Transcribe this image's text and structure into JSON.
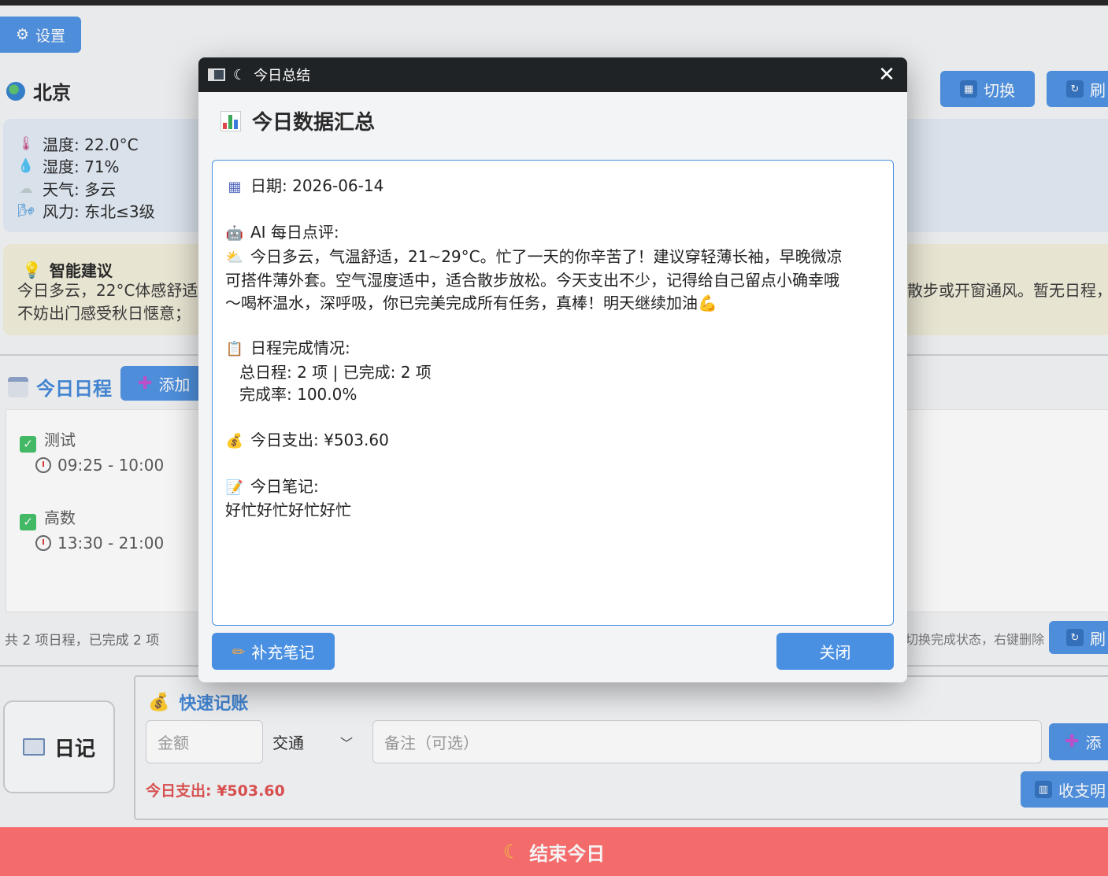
{
  "colors": {
    "accent": "#4a90e2",
    "end_day_bg": "#ff6b6b",
    "expense_red": "#e04c4c",
    "weather_bg": "#e2ebf6",
    "advice_bg": "#f2eedb",
    "titlebar": "#1f2326"
  },
  "header": {
    "settings_label": "设置",
    "settings_icon": "gear-icon",
    "city": "北京",
    "switch_label": "切换",
    "refresh_label": "刷"
  },
  "weather": {
    "temperature": "温度: 22.0°C",
    "humidity": "湿度: 71%",
    "condition": "天气: 多云",
    "wind": "风力: 东北≤3级"
  },
  "advice": {
    "title": "智能建议",
    "line1_left": "今日多云，22°C体感舒适",
    "line1_right": "散步或开窗通风。暂无日程，",
    "line2_left": "不妨出门感受秋日惬意；"
  },
  "schedule": {
    "title": "今日日程",
    "add_label": "添加",
    "items": [
      {
        "name": "测试",
        "time": "09:25 - 10:00"
      },
      {
        "name": "高数",
        "time": "13:30 - 21:00"
      }
    ],
    "footer": "共 2 项日程，已完成 2 项",
    "hint": "切换完成状态，右键删除",
    "refresh_label": "刷"
  },
  "diary": {
    "label": "日记"
  },
  "accounting": {
    "title": "快速记账",
    "amount_placeholder": "金额",
    "category_selected": "交通",
    "note_placeholder": "备注（可选）",
    "add_label": "添",
    "today_expense": "今日支出: ¥503.60",
    "stats_label": "收支明"
  },
  "end_day": {
    "label": "结束今日"
  },
  "modal": {
    "window_title": "今日总结",
    "heading": "今日数据汇总",
    "date_line": "日期: 2026-06-14",
    "ai_title": "AI 每日点评:",
    "ai_line1": "今日多云，气温舒适，21~29°C。忙了一天的你辛苦了！建议穿轻薄长袖，早晚微凉",
    "ai_line2": "可搭件薄外套。空气湿度适中，适合散步放松。今天支出不少，记得给自己留点小确幸哦",
    "ai_line3": "～喝杯温水，深呼吸，你已完美完成所有任务，真棒！明天继续加油💪",
    "sched_title": "日程完成情况:",
    "sched_line1": "总日程: 2 项 | 已完成: 2 项",
    "sched_line2": "完成率: 100.0%",
    "expense_line": "今日支出: ¥503.60",
    "notes_title": "今日笔记:",
    "notes_text": "好忙好忙好忙好忙",
    "supplement_label": "补充笔记",
    "close_label": "关闭",
    "close_glyph": "✕"
  }
}
